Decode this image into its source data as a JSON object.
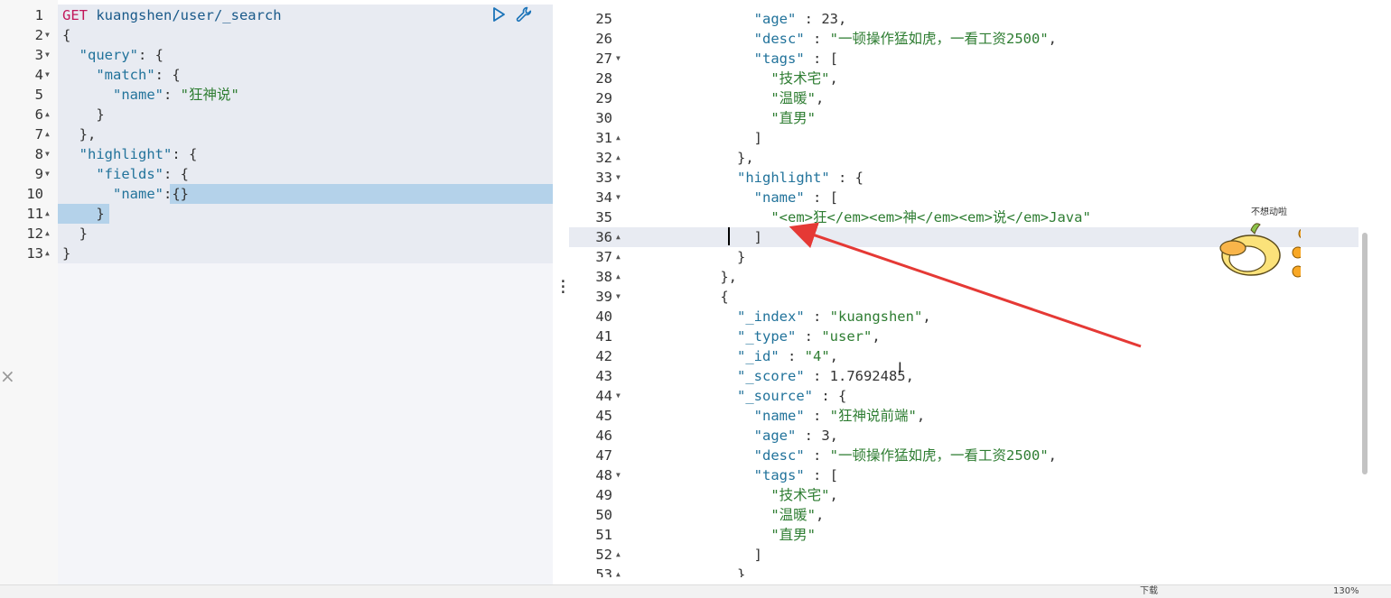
{
  "left_editor": {
    "lines": [
      {
        "n": "1",
        "fold": "",
        "parts": [
          [
            "m",
            "GET "
          ],
          [
            "n",
            "kuangshen/user/_search"
          ]
        ]
      },
      {
        "n": "2",
        "fold": "▼",
        "parts": [
          [
            "p",
            "{"
          ]
        ]
      },
      {
        "n": "3",
        "fold": "▼",
        "parts": [
          [
            "p",
            "  "
          ],
          [
            "k",
            "\"query\""
          ],
          [
            "p",
            ": {"
          ]
        ]
      },
      {
        "n": "4",
        "fold": "▼",
        "parts": [
          [
            "p",
            "    "
          ],
          [
            "k",
            "\"match\""
          ],
          [
            "p",
            ": {"
          ]
        ]
      },
      {
        "n": "5",
        "fold": "",
        "parts": [
          [
            "p",
            "      "
          ],
          [
            "k",
            "\"name\""
          ],
          [
            "p",
            ": "
          ],
          [
            "s",
            "\"狂神说\""
          ]
        ]
      },
      {
        "n": "6",
        "fold": "▲",
        "parts": [
          [
            "p",
            "    }"
          ]
        ]
      },
      {
        "n": "7",
        "fold": "▲",
        "parts": [
          [
            "p",
            "  },"
          ]
        ]
      },
      {
        "n": "8",
        "fold": "▼",
        "parts": [
          [
            "p",
            "  "
          ],
          [
            "k",
            "\"highlight\""
          ],
          [
            "p",
            ": {"
          ]
        ]
      },
      {
        "n": "9",
        "fold": "▼",
        "parts": [
          [
            "p",
            "    "
          ],
          [
            "k",
            "\"fields\""
          ],
          [
            "p",
            ": {"
          ]
        ]
      },
      {
        "n": "10",
        "fold": "",
        "parts": [
          [
            "p",
            "      "
          ],
          [
            "k",
            "\"name\""
          ],
          [
            "p",
            ":{}"
          ]
        ]
      },
      {
        "n": "11",
        "fold": "▲",
        "parts": [
          [
            "p",
            "    }"
          ]
        ]
      },
      {
        "n": "12",
        "fold": "▲",
        "parts": [
          [
            "p",
            "  }"
          ]
        ]
      },
      {
        "n": "13",
        "fold": "▲",
        "parts": [
          [
            "p",
            "}"
          ]
        ]
      }
    ]
  },
  "right_editor": {
    "lines": [
      {
        "n": "25",
        "fold": "",
        "parts": [
          [
            "p",
            "        "
          ],
          [
            "k",
            "\"age\""
          ],
          [
            "p",
            " : 23,"
          ]
        ]
      },
      {
        "n": "26",
        "fold": "",
        "parts": [
          [
            "p",
            "        "
          ],
          [
            "k",
            "\"desc\""
          ],
          [
            "p",
            " : "
          ],
          [
            "s",
            "\"一顿操作猛如虎，一看工资2500\""
          ],
          [
            "p",
            ","
          ]
        ]
      },
      {
        "n": "27",
        "fold": "▼",
        "parts": [
          [
            "p",
            "        "
          ],
          [
            "k",
            "\"tags\""
          ],
          [
            "p",
            " : ["
          ]
        ]
      },
      {
        "n": "28",
        "fold": "",
        "parts": [
          [
            "p",
            "          "
          ],
          [
            "s",
            "\"技术宅\""
          ],
          [
            "p",
            ","
          ]
        ]
      },
      {
        "n": "29",
        "fold": "",
        "parts": [
          [
            "p",
            "          "
          ],
          [
            "s",
            "\"温暖\""
          ],
          [
            "p",
            ","
          ]
        ]
      },
      {
        "n": "30",
        "fold": "",
        "parts": [
          [
            "p",
            "          "
          ],
          [
            "s",
            "\"直男\""
          ]
        ]
      },
      {
        "n": "31",
        "fold": "▲",
        "parts": [
          [
            "p",
            "        ]"
          ]
        ]
      },
      {
        "n": "32",
        "fold": "▲",
        "parts": [
          [
            "p",
            "      },"
          ]
        ]
      },
      {
        "n": "33",
        "fold": "▼",
        "parts": [
          [
            "p",
            "      "
          ],
          [
            "k",
            "\"highlight\""
          ],
          [
            "p",
            " : {"
          ]
        ]
      },
      {
        "n": "34",
        "fold": "▼",
        "parts": [
          [
            "p",
            "        "
          ],
          [
            "k",
            "\"name\""
          ],
          [
            "p",
            " : ["
          ]
        ]
      },
      {
        "n": "35",
        "fold": "",
        "parts": [
          [
            "p",
            "          "
          ],
          [
            "s",
            "\"<em>狂</em><em>神</em><em>说</em>Java\""
          ]
        ]
      },
      {
        "n": "36",
        "fold": "▲",
        "parts": [
          [
            "p",
            "        ]"
          ]
        ]
      },
      {
        "n": "37",
        "fold": "▲",
        "parts": [
          [
            "p",
            "      }"
          ]
        ]
      },
      {
        "n": "38",
        "fold": "▲",
        "parts": [
          [
            "p",
            "    },"
          ]
        ]
      },
      {
        "n": "39",
        "fold": "▼",
        "parts": [
          [
            "p",
            "    {"
          ]
        ]
      },
      {
        "n": "40",
        "fold": "",
        "parts": [
          [
            "p",
            "      "
          ],
          [
            "k",
            "\"_index\""
          ],
          [
            "p",
            " : "
          ],
          [
            "s",
            "\"kuangshen\""
          ],
          [
            "p",
            ","
          ]
        ]
      },
      {
        "n": "41",
        "fold": "",
        "parts": [
          [
            "p",
            "      "
          ],
          [
            "k",
            "\"_type\""
          ],
          [
            "p",
            " : "
          ],
          [
            "s",
            "\"user\""
          ],
          [
            "p",
            ","
          ]
        ]
      },
      {
        "n": "42",
        "fold": "",
        "parts": [
          [
            "p",
            "      "
          ],
          [
            "k",
            "\"_id\""
          ],
          [
            "p",
            " : "
          ],
          [
            "s",
            "\"4\""
          ],
          [
            "p",
            ","
          ]
        ]
      },
      {
        "n": "43",
        "fold": "",
        "parts": [
          [
            "p",
            "      "
          ],
          [
            "k",
            "\"_score\""
          ],
          [
            "p",
            " : 1.7692485,"
          ]
        ]
      },
      {
        "n": "44",
        "fold": "▼",
        "parts": [
          [
            "p",
            "      "
          ],
          [
            "k",
            "\"_source\""
          ],
          [
            "p",
            " : {"
          ]
        ]
      },
      {
        "n": "45",
        "fold": "",
        "parts": [
          [
            "p",
            "        "
          ],
          [
            "k",
            "\"name\""
          ],
          [
            "p",
            " : "
          ],
          [
            "s",
            "\"狂神说前端\""
          ],
          [
            "p",
            ","
          ]
        ]
      },
      {
        "n": "46",
        "fold": "",
        "parts": [
          [
            "p",
            "        "
          ],
          [
            "k",
            "\"age\""
          ],
          [
            "p",
            " : 3,"
          ]
        ]
      },
      {
        "n": "47",
        "fold": "",
        "parts": [
          [
            "p",
            "        "
          ],
          [
            "k",
            "\"desc\""
          ],
          [
            "p",
            " : "
          ],
          [
            "s",
            "\"一顿操作猛如虎，一看工资2500\""
          ],
          [
            "p",
            ","
          ]
        ]
      },
      {
        "n": "48",
        "fold": "▼",
        "parts": [
          [
            "p",
            "        "
          ],
          [
            "k",
            "\"tags\""
          ],
          [
            "p",
            " : ["
          ]
        ]
      },
      {
        "n": "49",
        "fold": "",
        "parts": [
          [
            "p",
            "          "
          ],
          [
            "s",
            "\"技术宅\""
          ],
          [
            "p",
            ","
          ]
        ]
      },
      {
        "n": "50",
        "fold": "",
        "parts": [
          [
            "p",
            "          "
          ],
          [
            "s",
            "\"温暖\""
          ],
          [
            "p",
            ","
          ]
        ]
      },
      {
        "n": "51",
        "fold": "",
        "parts": [
          [
            "p",
            "          "
          ],
          [
            "s",
            "\"直男\""
          ]
        ]
      },
      {
        "n": "52",
        "fold": "▲",
        "parts": [
          [
            "p",
            "        ]"
          ]
        ]
      },
      {
        "n": "53",
        "fold": "▲",
        "parts": [
          [
            "p",
            "      }"
          ]
        ]
      }
    ]
  },
  "icons": {
    "run": "play-icon",
    "settings": "wrench-icon",
    "close": "close-icon",
    "splitter": "drag-handle-icon"
  },
  "sticker": {
    "caption": "不想动啦"
  },
  "statusbar": {
    "download": "下载",
    "zoom": "130%"
  },
  "colors": {
    "method": "#c2185b",
    "key": "#22739b",
    "string": "#2e7d32",
    "arrow": "#e53935"
  }
}
